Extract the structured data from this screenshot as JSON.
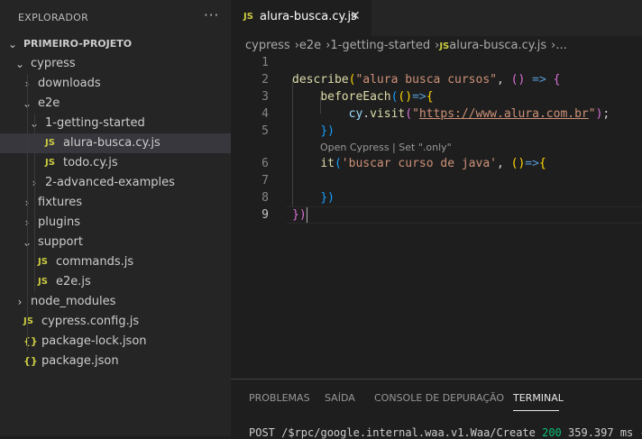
{
  "sidebar": {
    "title": "EXPLORADOR",
    "more": "···",
    "tree": [
      {
        "label": "PRIMEIRO-PROJETO",
        "chev": "⌄",
        "kind": "root"
      },
      {
        "label": "cypress",
        "chev": "⌄",
        "kind": "folder"
      },
      {
        "label": "downloads",
        "chev": "›",
        "kind": "folder"
      },
      {
        "label": "e2e",
        "chev": "⌄",
        "kind": "folder"
      },
      {
        "label": "1-getting-started",
        "chev": "⌄",
        "kind": "folder"
      },
      {
        "label": "alura-busca.cy.js",
        "icon": "JS",
        "kind": "js",
        "selected": true
      },
      {
        "label": "todo.cy.js",
        "icon": "JS",
        "kind": "js"
      },
      {
        "label": "2-advanced-examples",
        "chev": "›",
        "kind": "folder"
      },
      {
        "label": "fixtures",
        "chev": "›",
        "kind": "folder"
      },
      {
        "label": "plugins",
        "chev": "›",
        "kind": "folder"
      },
      {
        "label": "support",
        "chev": "⌄",
        "kind": "folder"
      },
      {
        "label": "commands.js",
        "icon": "JS",
        "kind": "js"
      },
      {
        "label": "e2e.js",
        "icon": "JS",
        "kind": "js"
      },
      {
        "label": "node_modules",
        "chev": "›",
        "kind": "folder"
      },
      {
        "label": "cypress.config.js",
        "icon": "JS",
        "kind": "js"
      },
      {
        "label": "package-lock.json",
        "icon": "{}",
        "kind": "json"
      },
      {
        "label": "package.json",
        "icon": "{}",
        "kind": "json"
      }
    ]
  },
  "tab": {
    "icon": "JS",
    "label": "alura-busca.cy.js",
    "close": "✕"
  },
  "breadcrumb": [
    "cypress",
    "e2e",
    "1-getting-started",
    "alura-busca.cy.js",
    "..."
  ],
  "breadcrumb_icon": "JS",
  "code": {
    "line_numbers": [
      "1",
      "2",
      "3",
      "4",
      "5",
      "6",
      "7",
      "8",
      "9"
    ],
    "l2": {
      "fn": "describe",
      "p1": "(",
      "str": "\"alura busca cursos\"",
      "sep": ", ",
      "p2": "()",
      "arrow": " => ",
      "brace": "{"
    },
    "l3": {
      "fn": "beforeEach",
      "p1": "(",
      "p2": "()",
      "arrow": "=>",
      "brace": "{"
    },
    "l4": {
      "obj": "cy",
      "dot": ".",
      "fn": "visit",
      "p1": "(",
      "q1": "\"",
      "url": "https://www.alura.com.br",
      "q2": "\"",
      "p2": ")",
      "semi": ";"
    },
    "l5": {
      "close": "})"
    },
    "codelens": "Open Cypress | Set \".only\"",
    "l6": {
      "fn": "it",
      "p1": "(",
      "str": "'buscar curso de java'",
      "sep": ", ",
      "p2": "()",
      "arrow": "=>",
      "brace": "{"
    },
    "l8": {
      "close": "})"
    },
    "l9": {
      "close": "})"
    }
  },
  "panel": {
    "tabs": [
      "PROBLEMAS",
      "SAÍDA",
      "CONSOLE DE DEPURAÇÃO",
      "TERMINAL"
    ],
    "active": "TERMINAL",
    "terminal_prefix": "POST /$rpc/google.internal.waa.v1.Waa/Create ",
    "terminal_num": "200",
    "terminal_suffix": " 359.397 ms -"
  }
}
